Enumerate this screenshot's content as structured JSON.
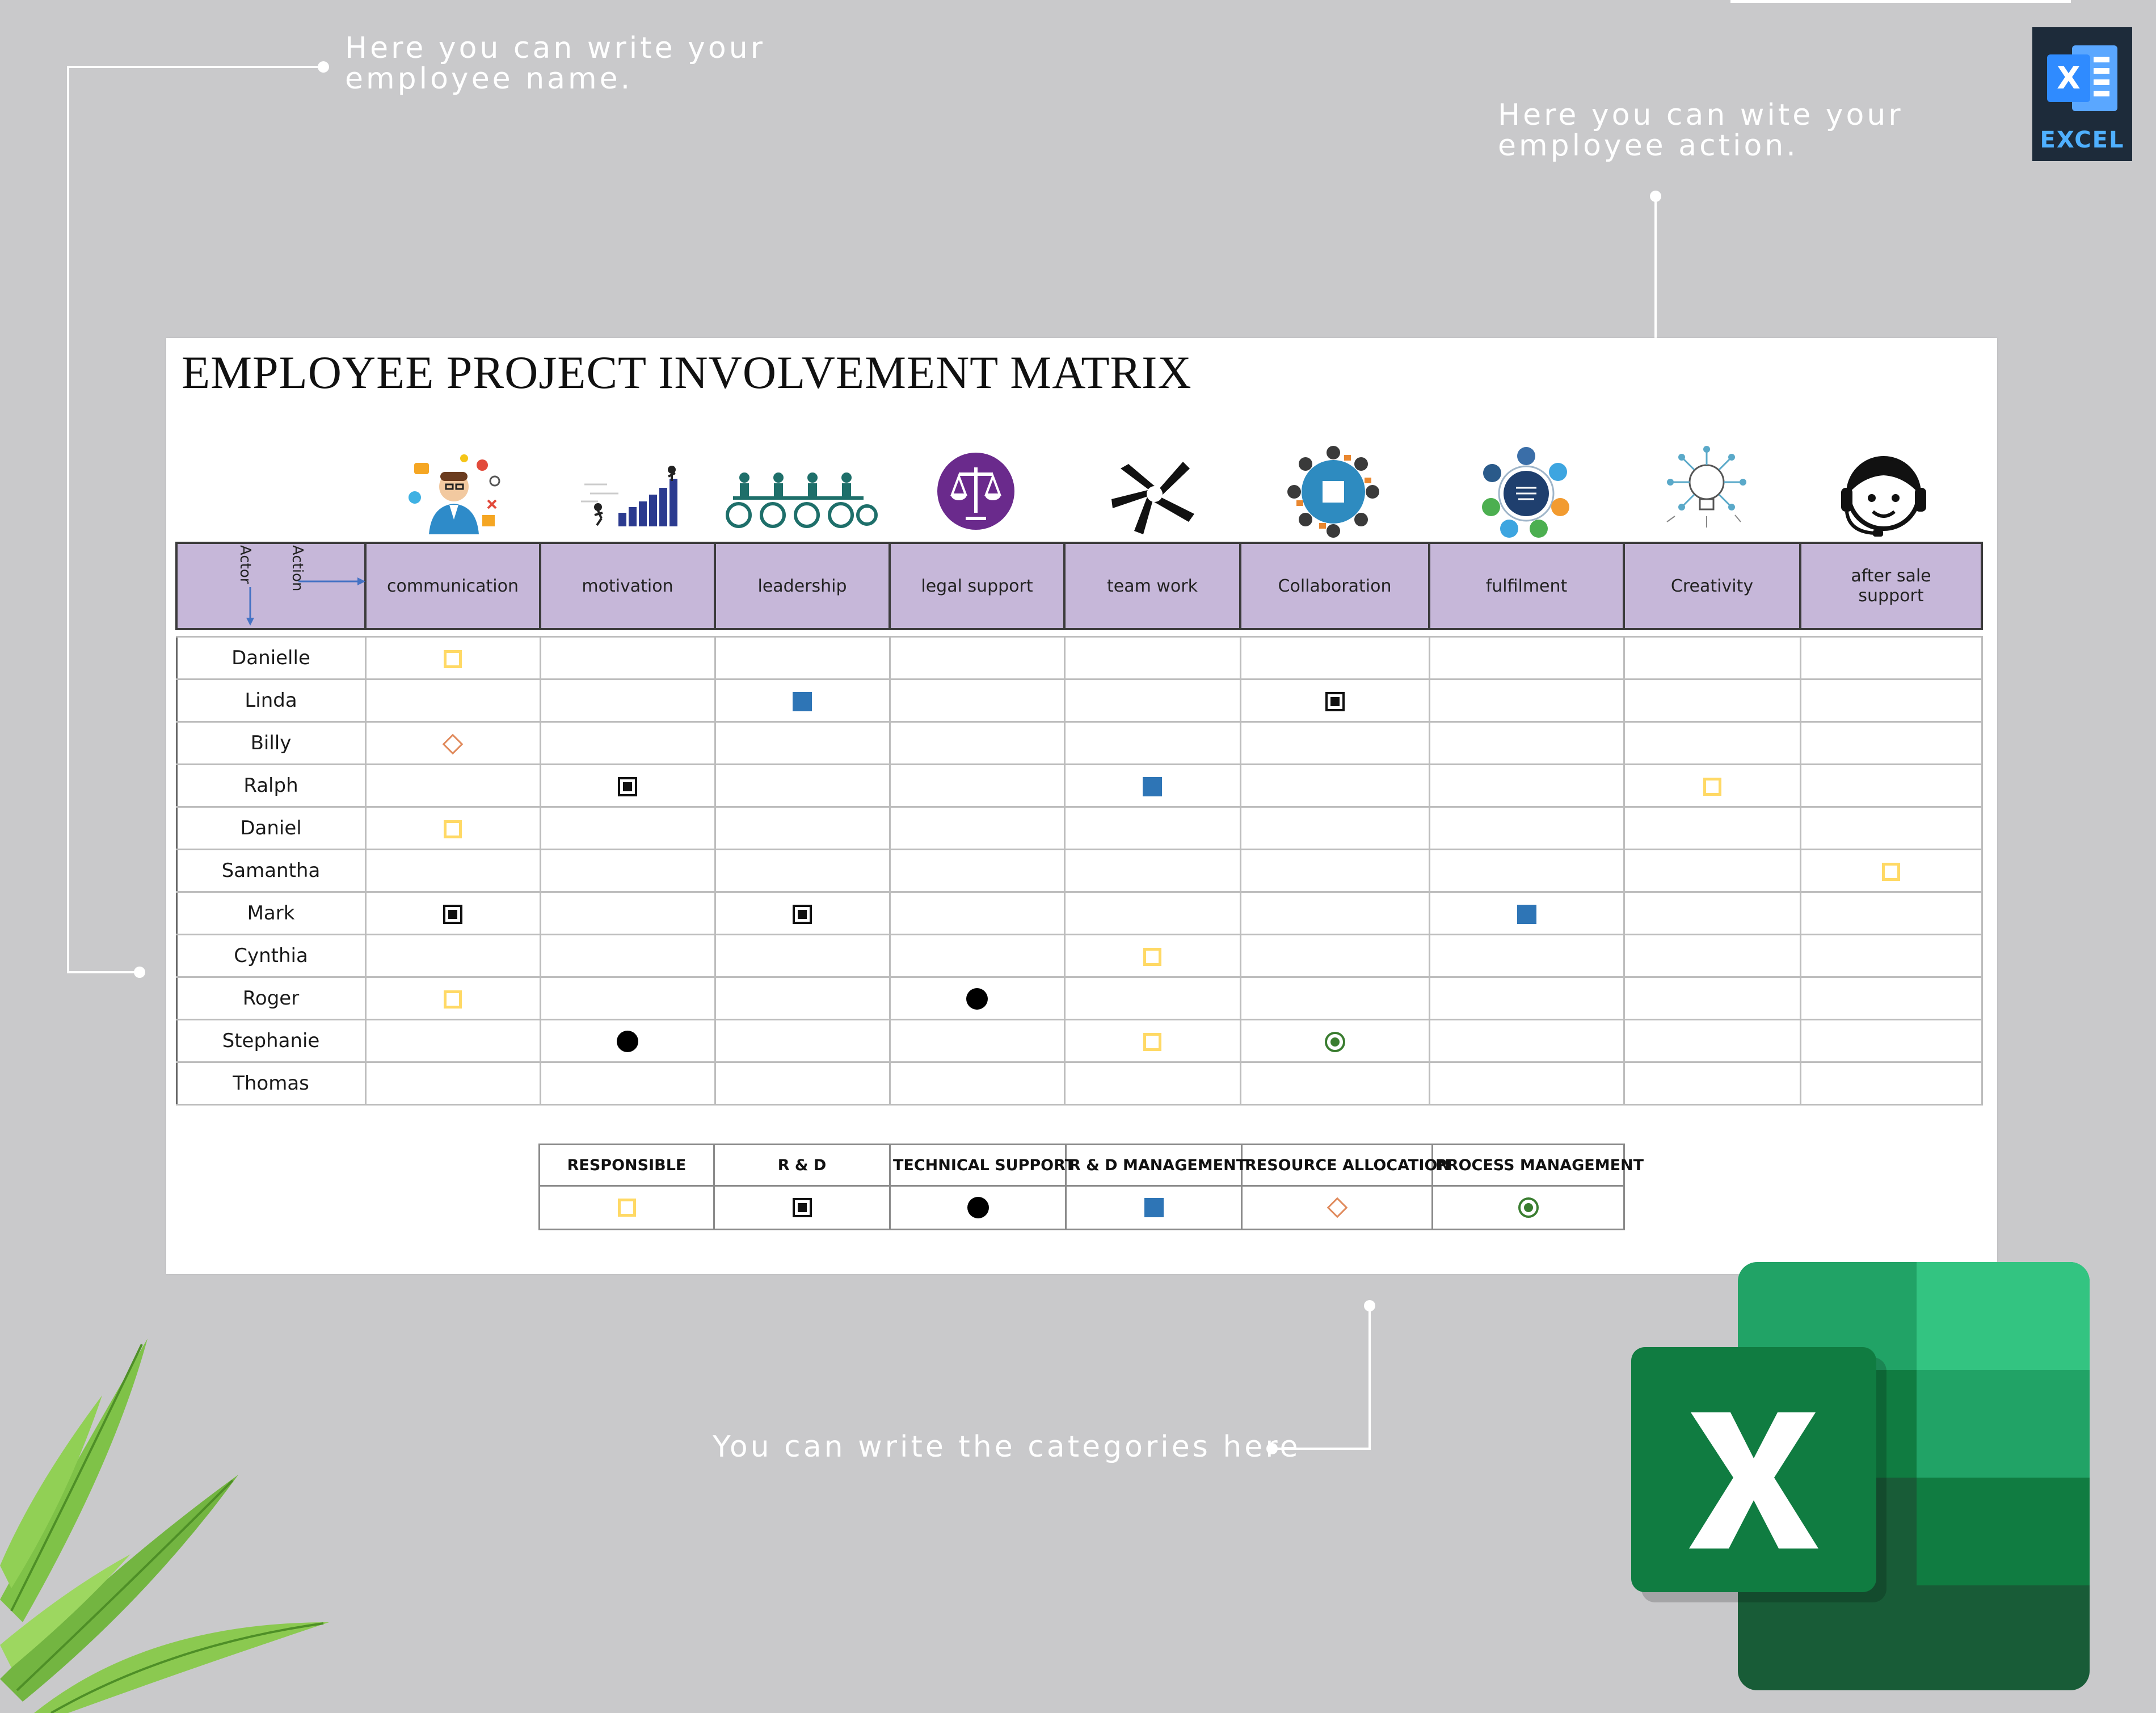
{
  "callouts": {
    "top_left": "Here you can write your\nemployee name.",
    "top_right": "Here you can wite your\nemployee action.",
    "bottom": "You can write the categories here"
  },
  "excel_badge": {
    "label": "EXCEL",
    "accent": "#1d2b3a"
  },
  "sheet": {
    "title": "EMPLOYEE PROJECT INVOLVEMENT MATRIX",
    "corner": {
      "action_label": "Action",
      "actor_label": "Actor"
    },
    "actions": [
      "communication",
      "motivation",
      "leadership",
      "legal support",
      "team work",
      "Collaboration",
      "fulfilment",
      "Creativity",
      "after sale support"
    ],
    "column_icons": [
      "communication-icon",
      "motivation-icon",
      "leadership-icon",
      "legal-scale-icon",
      "teamwork-hands-icon",
      "collaboration-icon",
      "fulfilment-icon",
      "creativity-lightbulb-icon",
      "customer-support-headset-icon"
    ],
    "header_color": "#c6b7d9",
    "rows": [
      {
        "name": "Danielle",
        "marks": [
          "responsible",
          "",
          "",
          "",
          "",
          "",
          "",
          "",
          ""
        ]
      },
      {
        "name": "Linda",
        "marks": [
          "",
          "",
          "rd_management",
          "",
          "",
          "rd",
          "",
          "",
          ""
        ]
      },
      {
        "name": "Billy",
        "marks": [
          "resource_allocation",
          "",
          "",
          "",
          "",
          "",
          "",
          "",
          ""
        ]
      },
      {
        "name": "Ralph",
        "marks": [
          "",
          "rd",
          "",
          "",
          "rd_management",
          "",
          "",
          "responsible",
          ""
        ]
      },
      {
        "name": "Daniel",
        "marks": [
          "responsible",
          "",
          "",
          "",
          "",
          "",
          "",
          "",
          ""
        ]
      },
      {
        "name": "Samantha",
        "marks": [
          "",
          "",
          "",
          "",
          "",
          "",
          "",
          "",
          "responsible"
        ]
      },
      {
        "name": "Mark",
        "marks": [
          "rd",
          "",
          "rd",
          "",
          "",
          "",
          "rd_management",
          "",
          ""
        ]
      },
      {
        "name": "Cynthia",
        "marks": [
          "",
          "",
          "",
          "",
          "responsible",
          "",
          "",
          "",
          ""
        ]
      },
      {
        "name": "Roger",
        "marks": [
          "responsible",
          "",
          "",
          "technical_support",
          "",
          "",
          "",
          "",
          ""
        ]
      },
      {
        "name": "Stephanie",
        "marks": [
          "",
          "technical_support",
          "",
          "",
          "responsible",
          "process_management",
          "",
          "",
          ""
        ]
      },
      {
        "name": "Thomas",
        "marks": [
          "",
          "",
          "",
          "",
          "",
          "",
          "",
          "",
          ""
        ]
      }
    ]
  },
  "legend": [
    {
      "key": "responsible",
      "label": "RESPONSIBLE"
    },
    {
      "key": "rd",
      "label": "R & D"
    },
    {
      "key": "technical_support",
      "label": "TECHNICAL SUPPORT"
    },
    {
      "key": "rd_management",
      "label": "R & D MANAGEMENT"
    },
    {
      "key": "resource_allocation",
      "label": "RESOURCE ALLOCATION"
    },
    {
      "key": "process_management",
      "label": "PROCESS MANAGEMENT"
    }
  ],
  "marker_colors": {
    "responsible": "#ffd965",
    "rd": "#111111",
    "technical_support": "#000000",
    "rd_management": "#2e75b6",
    "resource_allocation": "#e08a5c",
    "process_management": "#3a7d30"
  },
  "decor": {
    "excel_logo": "excel-logo-icon",
    "plant": "palm-leaf-decoration"
  }
}
